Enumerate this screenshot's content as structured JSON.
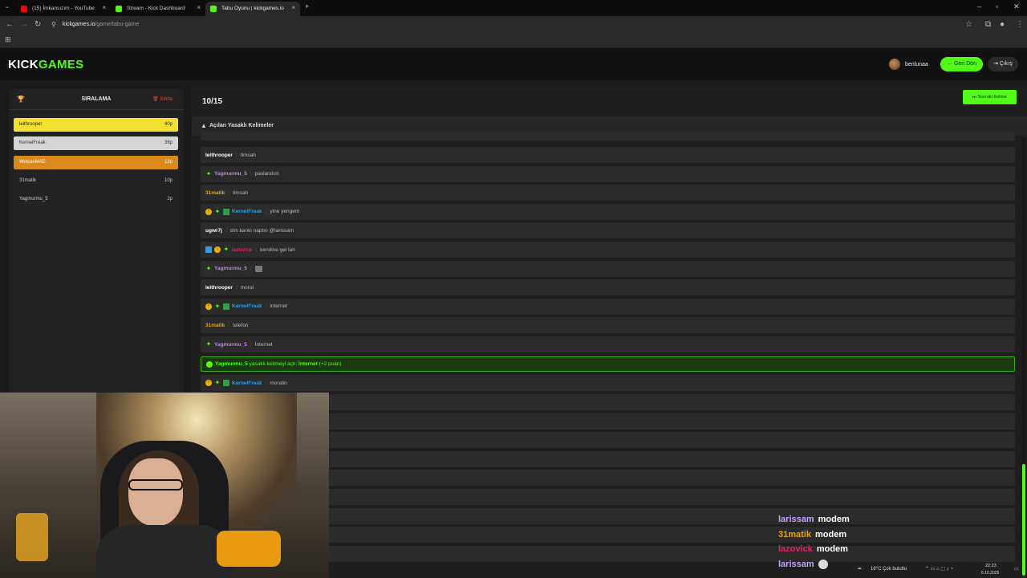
{
  "browser": {
    "tabs": [
      {
        "title": "(15) İmkansızım - YouTube",
        "color": "#ff0000"
      },
      {
        "title": "Stream - Kick Dashboard",
        "color": "#53fc18"
      },
      {
        "title": "Tabu Oyunu | kickgames.io",
        "color": "#53fc18"
      }
    ],
    "url_host": "kickgames.io",
    "url_path": "/game/tabu-game"
  },
  "header": {
    "logo_part1": "KICK",
    "logo_part2": "GAMES",
    "username": "benlunaa",
    "back_label": "← Geri Dön",
    "exit_label": "⇥ Çıkış"
  },
  "ranking": {
    "title": "SIRALAMA",
    "reset_label": "🗑 Sıfırla",
    "rows": [
      {
        "name": "leithrooper",
        "points": "40p",
        "bg": "#f5e130",
        "fg": "#222"
      },
      {
        "name": "KernelFreak",
        "points": "36p",
        "bg": "#d5d5d5",
        "fg": "#333"
      },
      {
        "name": "WolcanMAE",
        "points": "12p",
        "bg": "#d98a1a",
        "fg": "#fff"
      },
      {
        "name": "31matik",
        "points": "10p",
        "bg": "#222",
        "fg": "#ccc"
      },
      {
        "name": "Yagmurmu_5",
        "points": "2p",
        "bg": "#222",
        "fg": "#ccc"
      }
    ]
  },
  "game": {
    "counter": "10/15",
    "next_label": "⏭ Sonraki Kelime",
    "section_title": "Açılan Yasaklı Kelimeler"
  },
  "messages": [
    {
      "user": "leithrooper",
      "color": "#ffffff",
      "badges": [],
      "text": "timsah"
    },
    {
      "user": "Yagmurmu_5",
      "color": "#c77dff",
      "badges": [
        "star"
      ],
      "text": "paslandım"
    },
    {
      "user": "31matik",
      "color": "#f0a500",
      "badges": [],
      "text": "timsah"
    },
    {
      "user": "KernelFreak",
      "color": "#3a9ad9",
      "badges": [
        "coin",
        "star",
        "gift"
      ],
      "text": "yine yengem"
    },
    {
      "user": "ugwr7j",
      "color": "#ffffff",
      "badges": [],
      "text": "slm kanki naptın @larissam"
    },
    {
      "user": "lazovick",
      "color": "#e0245e",
      "badges": [
        "blue",
        "coin",
        "star"
      ],
      "text": "kendine gel lan"
    },
    {
      "user": "Yagmurmu_5",
      "color": "#c77dff",
      "badges": [
        "star"
      ],
      "text": "",
      "emote": true
    },
    {
      "user": "leithrooper",
      "color": "#ffffff",
      "badges": [],
      "text": "moral"
    },
    {
      "user": "KernelFreak",
      "color": "#3a9ad9",
      "badges": [
        "coin",
        "star",
        "gift"
      ],
      "text": "internet"
    },
    {
      "user": "31matik",
      "color": "#f0a500",
      "badges": [],
      "text": "telefon"
    },
    {
      "user": "Yagmurmu_5",
      "color": "#c77dff",
      "badges": [
        "star"
      ],
      "text": "İnternet"
    }
  ],
  "system_message": {
    "user": "Yagmurmu_5",
    "middle": " yasaklı kelimeyi açtı: ",
    "word": "İnternet",
    "bonus": " (+2 puan)"
  },
  "last_message": {
    "user": "KernelFreak",
    "color": "#3a9ad9",
    "badges": [
      "coin",
      "star",
      "gift"
    ],
    "text": "moralin"
  },
  "overlay_chat": [
    {
      "user": "larissam",
      "color": "#c9a0ff",
      "text": "modem"
    },
    {
      "user": "31matik",
      "color": "#f0a500",
      "text": "modem"
    },
    {
      "user": "lazovick",
      "color": "#e0245e",
      "text": "modem"
    },
    {
      "user": "larissam",
      "color": "#c9a0ff",
      "text": ""
    }
  ],
  "tray": {
    "weather": "18°C  Çok bulutlu",
    "time": "22:23",
    "date": "6.10.2025"
  }
}
